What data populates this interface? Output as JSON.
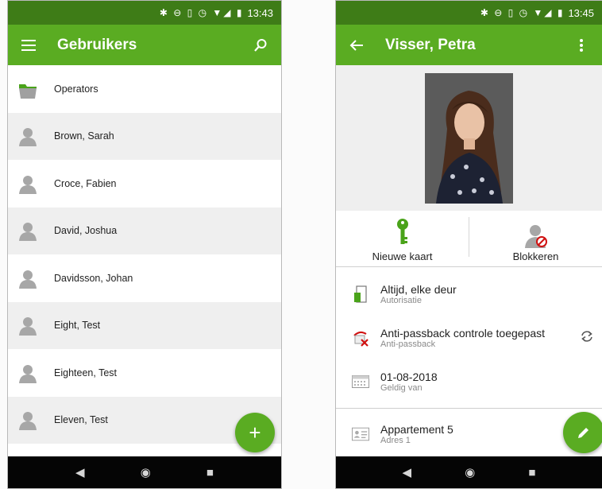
{
  "left": {
    "status_time": "13:43",
    "status_icons": "✱ ⊖ ▯ ◷ ▼◢ ▮",
    "app_title": "Gebruikers",
    "items": [
      {
        "label": "Operators",
        "kind": "folder"
      },
      {
        "label": "Brown, Sarah",
        "kind": "user"
      },
      {
        "label": "Croce, Fabien",
        "kind": "user"
      },
      {
        "label": "David, Joshua",
        "kind": "user"
      },
      {
        "label": "Davidsson, Johan",
        "kind": "user"
      },
      {
        "label": "Eight, Test",
        "kind": "user"
      },
      {
        "label": "Eighteen, Test",
        "kind": "user"
      },
      {
        "label": "Eleven, Test",
        "kind": "user"
      }
    ],
    "fab_symbol": "+"
  },
  "right": {
    "status_time": "13:45",
    "status_icons": "✱ ⊖ ▯ ◷ ▼◢ ▮",
    "app_title": "Visser, Petra",
    "actions": {
      "new_card": "Nieuwe kaart",
      "block": "Blokkeren"
    },
    "details": [
      {
        "primary": "Altijd, elke deur",
        "secondary": "Autorisatie",
        "icon": "door-icon"
      },
      {
        "primary": "Anti-passback controle toegepast",
        "secondary": "Anti-passback",
        "icon": "anti-passback-icon"
      },
      {
        "primary": "01-08-2018",
        "secondary": "Geldig van",
        "icon": "calendar-icon"
      },
      {
        "primary": "Appartement 5",
        "secondary": "Adres 1",
        "icon": "address-card-icon"
      }
    ]
  },
  "navbar": {
    "back": "◀",
    "home": "◉",
    "recents": "■"
  },
  "colors": {
    "appbar": "#5aac22",
    "statusbar": "#3e7c17",
    "list_alt_row": "#efefef",
    "accent_key": "#4aa31a"
  }
}
